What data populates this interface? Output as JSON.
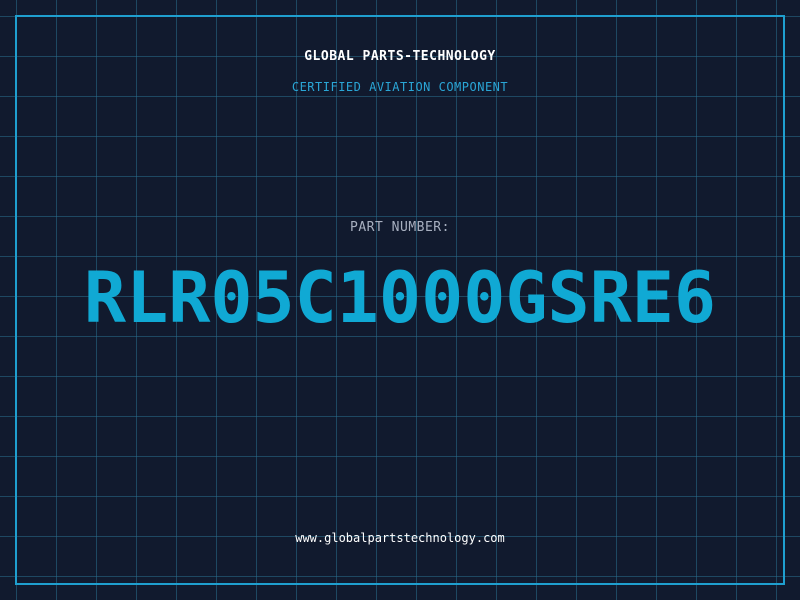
{
  "header": {
    "company": "GLOBAL PARTS-TECHNOLOGY",
    "subtitle": "CERTIFIED AVIATION COMPONENT"
  },
  "part": {
    "label": "PART NUMBER:",
    "number": "RLR05C1000GSRE6"
  },
  "footer": {
    "url": "www.globalpartstechnology.com"
  },
  "colors": {
    "background": "#111a2e",
    "accent": "#10a9d4",
    "grid": "#286e8c"
  }
}
